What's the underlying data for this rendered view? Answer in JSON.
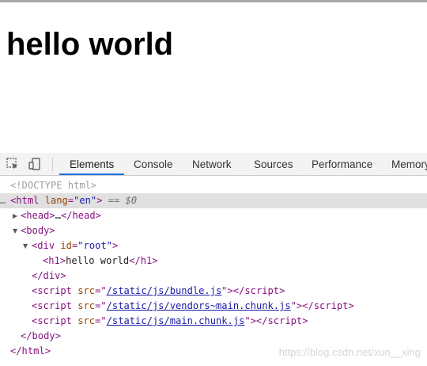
{
  "page": {
    "heading": "hello world"
  },
  "devtools": {
    "tabs": [
      {
        "label": "Elements",
        "active": true
      },
      {
        "label": "Console"
      },
      {
        "label": "Network"
      },
      {
        "label": "Sources"
      },
      {
        "label": "Performance"
      },
      {
        "label": "Memory"
      }
    ],
    "icons": [
      "inspect-icon",
      "device-toolbar-icon"
    ],
    "accent": "#1a73e8",
    "dom": {
      "doctype": "<!DOCTYPE html>",
      "gutter": "…",
      "html_open": "html",
      "html_attr_name": "lang",
      "html_attr_value": "\"en\"",
      "selected_marker": "== $0",
      "head_open": "head",
      "head_ellipsis": "…",
      "head_close": "/head",
      "body_open": "body",
      "div_open": "div",
      "div_attr_name": "id",
      "div_attr_value": "\"root\"",
      "h1_open": "h1",
      "h1_text": "hello world",
      "h1_close": "/h1",
      "div_close": "/div",
      "script_tag": "script",
      "script_attr_name": "src",
      "script_close": "/script",
      "scripts": [
        "/static/js/bundle.js",
        "/static/js/vendors~main.chunk.js",
        "/static/js/main.chunk.js"
      ],
      "body_close": "/body",
      "html_close": "/html"
    }
  },
  "watermark": "https://blog.csdn.net/xun__xing"
}
